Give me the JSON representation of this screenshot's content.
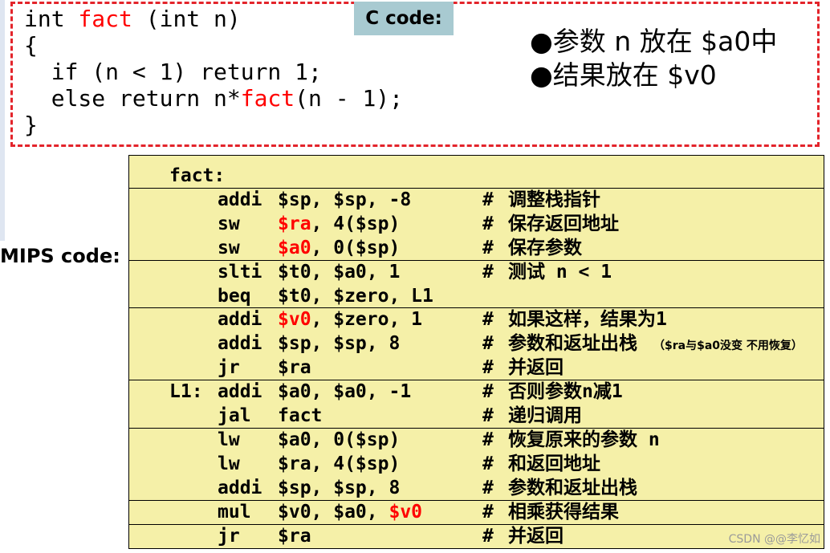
{
  "c_code": {
    "label": "C code:",
    "lines": [
      {
        "pre": "int ",
        "hl": "fact",
        "post": " (int n)"
      },
      {
        "pre": "{",
        "hl": "",
        "post": ""
      },
      {
        "pre": "  if (n < 1) return 1;",
        "hl": "",
        "post": ""
      },
      {
        "pre": "  else return n*",
        "hl": "fact",
        "post": "(n - 1);"
      },
      {
        "pre": "}",
        "hl": "",
        "post": ""
      }
    ]
  },
  "notes": [
    "●参数 n 放在 $a0中",
    "●结果放在 $v0"
  ],
  "mips": {
    "label": "MIPS code:",
    "rows": [
      {
        "label": "fact:",
        "op": "",
        "a1": "",
        "a2": "",
        "a3": "",
        "comment": "",
        "note": ""
      },
      {
        "label": "",
        "op": "addi",
        "a1": "",
        "a2": "$sp, $sp, -8",
        "a3": "",
        "comment": "调整栈指针",
        "note": ""
      },
      {
        "label": "",
        "op": "sw",
        "a1": "$ra",
        "a2": ", 4($sp)",
        "a3": "",
        "comment": "保存返回地址",
        "note": ""
      },
      {
        "label": "",
        "op": "sw",
        "a1": "$a0",
        "a2": ", 0($sp)",
        "a3": "",
        "comment": "保存参数",
        "note": ""
      },
      {
        "label": "",
        "op": "slti",
        "a1": "",
        "a2": "$t0, $a0, 1",
        "a3": "",
        "comment": "测试 n < 1",
        "note": ""
      },
      {
        "label": "",
        "op": "beq",
        "a1": "",
        "a2": "$t0, $zero, L1",
        "a3": "",
        "comment": "",
        "note": ""
      },
      {
        "label": "",
        "op": "addi",
        "a1": "$v0",
        "a2": ", $zero, 1",
        "a3": "",
        "comment": "如果这样，结果为1",
        "note": ""
      },
      {
        "label": "",
        "op": "addi",
        "a1": "",
        "a2": "$sp, $sp, 8",
        "a3": "",
        "comment": "参数和返址出栈",
        "note": "（$ra与$a0没变 不用恢复）"
      },
      {
        "label": "",
        "op": "jr",
        "a1": "",
        "a2": "$ra",
        "a3": "",
        "comment": "并返回",
        "note": ""
      },
      {
        "label": "L1:",
        "op": "addi",
        "a1": "",
        "a2": "$a0, $a0, -1",
        "a3": "",
        "comment": "否则参数n减1",
        "note": ""
      },
      {
        "label": "",
        "op": "jal",
        "a1": "",
        "a2": "fact",
        "a3": "",
        "comment": "递归调用",
        "note": ""
      },
      {
        "label": "",
        "op": "lw",
        "a1": "",
        "a2": "$a0, 0($sp)",
        "a3": "",
        "comment": "恢复原来的参数 n",
        "note": ""
      },
      {
        "label": "",
        "op": "lw",
        "a1": "",
        "a2": "$ra, 4($sp)",
        "a3": "",
        "comment": "和返回地址",
        "note": ""
      },
      {
        "label": "",
        "op": "addi",
        "a1": "",
        "a2": "$sp, $sp, 8",
        "a3": "",
        "comment": "参数和返址出栈",
        "note": ""
      },
      {
        "label": "",
        "op": "mul",
        "a1": "",
        "a2": "$v0, $a0, ",
        "a3": "$v0",
        "comment": "相乘获得结果",
        "note": ""
      },
      {
        "label": "",
        "op": "jr",
        "a1": "",
        "a2": "$ra",
        "a3": "",
        "comment": "并返回",
        "note": ""
      }
    ],
    "separators_after": [
      0,
      3,
      5,
      8,
      10,
      13,
      14
    ]
  },
  "watermark": "CSDN @@李忆如",
  "colors": {
    "highlight": "#ff0000",
    "code_bg": "#f5f0a8",
    "border": "#e3242b",
    "label_bg": "#a8cad1"
  }
}
